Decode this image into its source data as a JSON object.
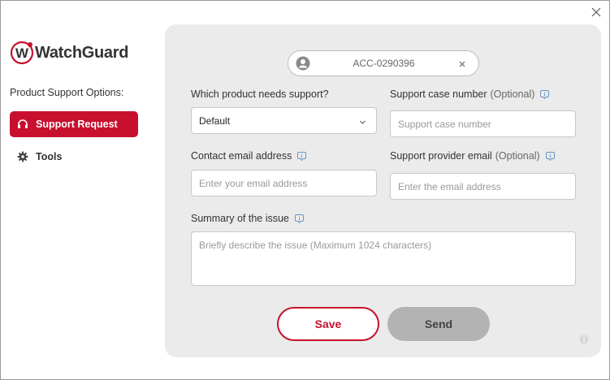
{
  "brand": {
    "name": "WatchGuard",
    "accent": "#c8102e"
  },
  "window": {
    "close_icon": "close-icon"
  },
  "sidebar": {
    "title": "Product Support Options:",
    "items": [
      {
        "label": "Support Request",
        "icon": "headset-icon",
        "active": true
      },
      {
        "label": "Tools",
        "icon": "gear-icon",
        "active": false
      }
    ]
  },
  "account": {
    "id": "ACC-0290396"
  },
  "form": {
    "product": {
      "label": "Which product needs support?",
      "value": "Default"
    },
    "case_number": {
      "label": "Support case number",
      "optional": "(Optional)",
      "placeholder": "Support case number"
    },
    "contact_email": {
      "label": "Contact email address",
      "placeholder": "Enter your email address"
    },
    "provider_email": {
      "label": "Support provider email",
      "optional": "(Optional)",
      "placeholder": "Enter the email address"
    },
    "summary": {
      "label": "Summary of the issue",
      "placeholder": "Briefly describe the issue (Maximum 1024 characters)"
    }
  },
  "actions": {
    "save": "Save",
    "send": "Send"
  }
}
